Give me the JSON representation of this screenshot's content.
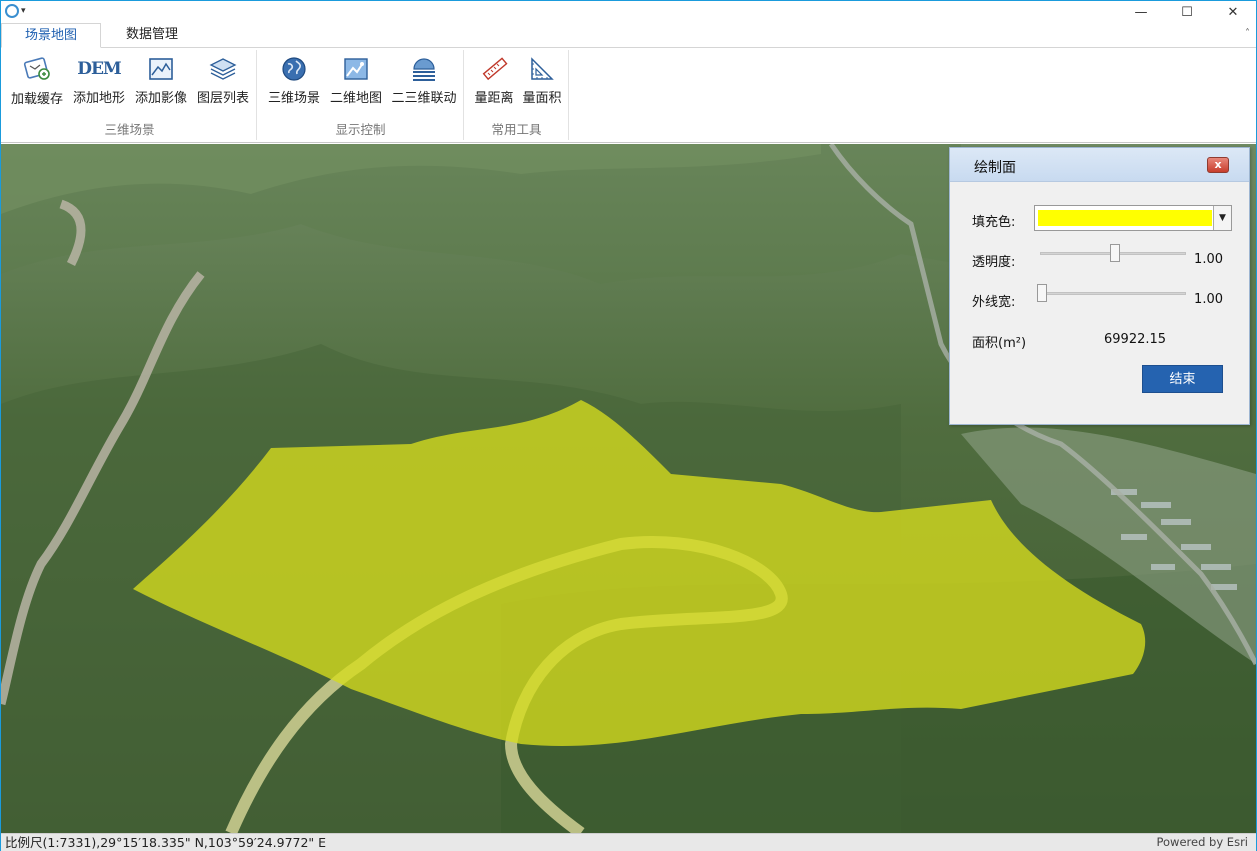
{
  "window": {
    "minimize_glyph": "—",
    "maximize_glyph": "☐",
    "close_glyph": "✕",
    "qat_arrow": "▾"
  },
  "tabs": [
    {
      "label": "场景地图",
      "active": true
    },
    {
      "label": "数据管理",
      "active": false
    }
  ],
  "ribbon": {
    "collapse_glyph": "˄",
    "groups": [
      {
        "label": "三维场景",
        "buttons": [
          {
            "label": "加载缓存",
            "icon": "load-cache-icon"
          },
          {
            "label": "添加地形",
            "icon": "dem-icon"
          },
          {
            "label": "添加影像",
            "icon": "image-icon"
          },
          {
            "label": "图层列表",
            "icon": "layers-icon"
          }
        ]
      },
      {
        "label": "显示控制",
        "buttons": [
          {
            "label": "三维场景",
            "icon": "globe-icon"
          },
          {
            "label": "二维地图",
            "icon": "map-icon"
          },
          {
            "label": "二三维联动",
            "icon": "link-icon"
          }
        ]
      },
      {
        "label": "常用工具",
        "buttons": [
          {
            "label": "量距离",
            "icon": "ruler-icon"
          },
          {
            "label": "量面积",
            "icon": "area-icon"
          }
        ]
      }
    ],
    "dem_text": "DEM"
  },
  "dialog": {
    "title": "绘制面",
    "close_glyph": "x",
    "fill_label": "填充色:",
    "fill_color": "#ffff00",
    "dropdown_glyph": "▼",
    "opacity_label": "透明度:",
    "opacity_value": "1.00",
    "outline_label": "外线宽:",
    "outline_value": "1.00",
    "area_label": "面积(m²)",
    "area_value": "69922.15",
    "finish_label": "结束"
  },
  "status": {
    "scale_coords": "比例尺(1:7331),29°15′18.335\" N,103°59′24.9772\" E",
    "powered_by": "Powered by Esri"
  },
  "colors": {
    "accent": "#1e5fb0",
    "polygon_fill": "#d6dc1e",
    "terrain": "#4d6b3e"
  }
}
